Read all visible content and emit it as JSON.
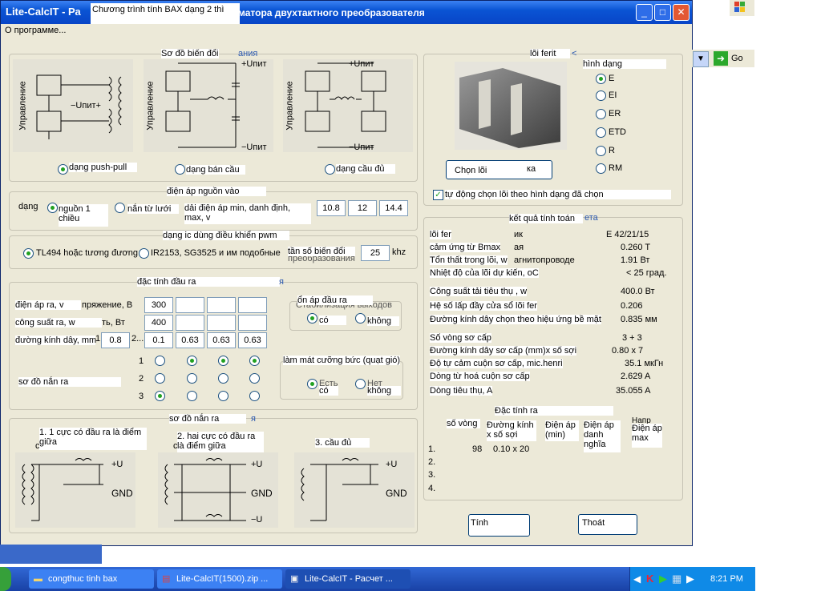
{
  "window": {
    "title": "Lite-CalcIT - Ра",
    "title_rest": "матора двухтактного преобразователя",
    "overlay": "Chương trình tính BAX dạng 2 thì",
    "menu_item": "О программе..."
  },
  "background_app": {
    "go_label": "Go"
  },
  "scheme_group": {
    "title": "Sơ đồ biến đổi",
    "title_suffix": "ания",
    "options": [
      {
        "label": "dạng push-pull",
        "selected": true
      },
      {
        "label": "dạng bán cầu",
        "selected": false
      },
      {
        "label": "dạng cầu đủ",
        "selected": false
      }
    ],
    "diagram_texts": {
      "control": "Управление",
      "upit_plus": "+Uпит",
      "upit_minus": "−Uпит",
      "upit_mid": "−Uпит+"
    }
  },
  "supply_group": {
    "title": "điện áp nguồn vào",
    "type_label": "dạng",
    "opt1": "nguồn 1 chiều",
    "opt2": "nắn từ lưới",
    "range_label": "dải điện áp min, danh định, max, v",
    "values": [
      "10.8",
      "12",
      "14.4"
    ]
  },
  "ic_group": {
    "title": "dạng ic dùng  điều khiển pwm",
    "opt1": "TL494 hoặc tương đương",
    "opt2": "IR2153, SG3525 и им подобные",
    "freq_label": "tần số biến đổi",
    "freq_sub": "преобразования",
    "freq_value": "25",
    "freq_unit": "khz"
  },
  "output_group": {
    "title": "đặc tính đầu ra",
    "title_suffix": "я",
    "rows": [
      {
        "label": "điện áp ra, v",
        "label_rest": "пряжение, В",
        "values": [
          "300",
          "",
          "",
          ""
        ]
      },
      {
        "label": "công suất ra, w",
        "label_rest": "ть, Вт",
        "values": [
          "400",
          "",
          "",
          ""
        ]
      },
      {
        "label": "đường kính dây, mm",
        "extra": "1",
        "extra2": "2...",
        "values": [
          "0.8",
          "0.1",
          "0.63",
          "0.63",
          "0.63"
        ]
      }
    ],
    "rect_label": "sơ đồ nắn ra",
    "rect_numbers": [
      "1",
      "2",
      "3"
    ],
    "stab_title": "ổn áp đầu ra",
    "stab_sub": "Стабилизация выходов",
    "stab_yes": "có",
    "stab_no": "không",
    "cool_title": "làm mát cưỡng bức (quạt gió)",
    "cool_yes": "có",
    "cool_no": "không",
    "cool_yes_ru": "Есть",
    "cool_no_ru": "Нет"
  },
  "rect_group": {
    "title": "sơ đồ nắn ra",
    "title_suffix": "я",
    "labels": [
      "1. 1 cực có đầu ra là điểm giữa",
      "2. hai cực có đầu ra là điểm giữa",
      "3. cầu đủ"
    ],
    "prefix": [
      "co c",
      "co c"
    ],
    "terms": {
      "plus_u": "+U",
      "gnd": "GND",
      "minus_u": "−U"
    }
  },
  "core_group": {
    "title": "lõi ferit",
    "title_suffix": "<",
    "shape_label": "hình dạng",
    "shapes": [
      {
        "label": "E",
        "selected": true
      },
      {
        "label": "EI",
        "selected": false
      },
      {
        "label": "ER",
        "selected": false
      },
      {
        "label": "ETD",
        "selected": false
      },
      {
        "label": "R",
        "selected": false
      },
      {
        "label": "RM",
        "selected": false
      }
    ],
    "choose_button": "Chọn lõi",
    "choose_suffix": "ка",
    "auto_label": "tự động chọn lõi theo hình dạng đã chọn",
    "auto_checked": true
  },
  "results_group": {
    "title": "kết quả tính toán",
    "title_suffix": "ета",
    "rows": [
      {
        "label": "lõi fer",
        "value": "E 42/21/15",
        "suffix": "ик"
      },
      {
        "label": "cảm ứng từ Bmax",
        "value": "0.260 T",
        "suffix": "ая"
      },
      {
        "label": "Tổn thất trong lõi, w",
        "value": "1.91 Вт",
        "suffix": "агнитопроводе"
      },
      {
        "label": "Nhiệt độ của lõi  dự kiến, oC",
        "value": "< 25 град."
      },
      {
        "label": "Công suất tải tiêu thụ , w",
        "value": "400.0 Вт",
        "suffix": "ь"
      },
      {
        "label": "Hệ số lấp đầy cửa sổ lõi fer",
        "value": "0.206"
      },
      {
        "label": "Đường kính dây chọn theo hiệu ứng bề mặt",
        "value": "0.835 мм"
      },
      {
        "label": "Số vòng  sơ cấp",
        "value": "3 + 3"
      },
      {
        "label": "Đường kính dây sơ cấp (mm)x số sợi",
        "value": "0.80 x 7"
      },
      {
        "label": "Độ tự cảm cuộn sơ cấp, mic.henri",
        "value": "35.1 мкГн",
        "suffix": "ки"
      },
      {
        "label": "Dòng từ hoá cuộn sơ cấp",
        "value": "2.629 A",
        "suffix": "и"
      },
      {
        "label": "Dòng  tiêu thụ, A",
        "value": "35.055 A"
      }
    ],
    "secondary_title": "Đặc tính ra",
    "columns": [
      "số vòng",
      "Đường kính x số sợi",
      "Điện áp (min)",
      "Điện áp danh nghĩa",
      "Điện áp max"
    ],
    "col_ru": "Напр",
    "secondary_rows": [
      {
        "n": "1.",
        "turns": "98",
        "wire": "0.10 x 20"
      },
      {
        "n": "2."
      },
      {
        "n": "3."
      },
      {
        "n": "4."
      }
    ]
  },
  "buttons": {
    "calc": "Tính",
    "exit": "Thoát"
  },
  "taskbar": {
    "items": [
      "congthuc tinh bax",
      "Lite-CalcIT(1500).zip ...",
      "Lite-CalcIT - Расчет ..."
    ],
    "clock": "8:21 PM"
  }
}
